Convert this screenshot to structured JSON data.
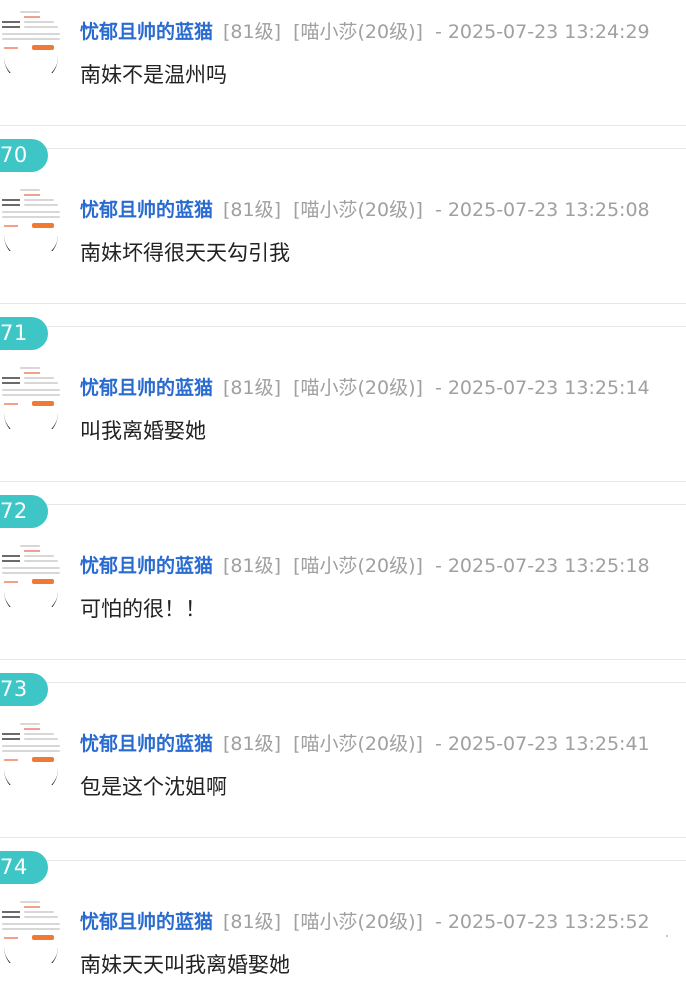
{
  "thread": {
    "posts": [
      {
        "floor": "",
        "username": "忧郁且帅的蓝猫",
        "level": "[81级]",
        "title": "[喵小莎(20级)]",
        "timestamp": "- 2025-07-23 13:24:29",
        "content": "南妹不是温州吗"
      },
      {
        "floor": "70",
        "username": "忧郁且帅的蓝猫",
        "level": "[81级]",
        "title": "[喵小莎(20级)]",
        "timestamp": "- 2025-07-23 13:25:08",
        "content": "南妹坏得很天天勾引我"
      },
      {
        "floor": "71",
        "username": "忧郁且帅的蓝猫",
        "level": "[81级]",
        "title": "[喵小莎(20级)]",
        "timestamp": "- 2025-07-23 13:25:14",
        "content": "叫我离婚娶她"
      },
      {
        "floor": "72",
        "username": "忧郁且帅的蓝猫",
        "level": "[81级]",
        "title": "[喵小莎(20级)]",
        "timestamp": "- 2025-07-23 13:25:18",
        "content": "可怕的很！！"
      },
      {
        "floor": "73",
        "username": "忧郁且帅的蓝猫",
        "level": "[81级]",
        "title": "[喵小莎(20级)]",
        "timestamp": "- 2025-07-23 13:25:41",
        "content": "包是这个沈姐啊"
      },
      {
        "floor": "74",
        "username": "忧郁且帅的蓝猫",
        "level": "[81级]",
        "title": "[喵小莎(20级)]",
        "timestamp": "- 2025-07-23 13:25:52",
        "content": "南妹天天叫我离婚娶她"
      }
    ]
  },
  "colors": {
    "badge": "#3ec6c6",
    "username": "#2a6bd0",
    "meta": "#a0a0a0",
    "text": "#222222",
    "divider": "#e6e6e6"
  }
}
